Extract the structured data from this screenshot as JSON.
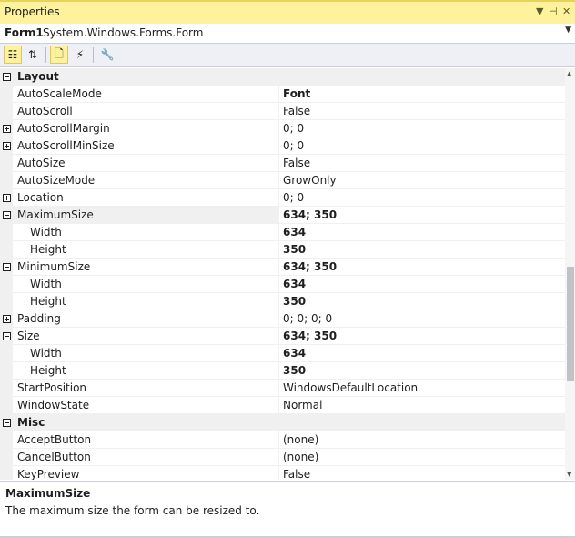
{
  "window": {
    "title": "Properties",
    "buttons": [
      "▼",
      "⊣",
      "✕"
    ]
  },
  "object_selector": {
    "name": "Form1",
    "type": "System.Windows.Forms.Form"
  },
  "toolbar": {
    "buttons": [
      {
        "name": "categorized-button",
        "glyph": "☷",
        "active": true
      },
      {
        "name": "alphabetical-button",
        "glyph": "⇅",
        "active": false
      },
      {
        "name": "properties-button",
        "glyph": "🗋",
        "active": true
      },
      {
        "name": "events-button",
        "glyph": "⚡",
        "active": false
      },
      {
        "name": "property-pages-button",
        "glyph": "🔧",
        "active": false,
        "disabled": true
      }
    ]
  },
  "grid": {
    "rows": [
      {
        "kind": "category",
        "name": "Layout",
        "expander": "minus"
      },
      {
        "kind": "prop",
        "name": "AutoScaleMode",
        "value": "Font",
        "bold": true
      },
      {
        "kind": "prop",
        "name": "AutoScroll",
        "value": "False"
      },
      {
        "kind": "prop",
        "name": "AutoScrollMargin",
        "value": "0; 0",
        "expander": "plus"
      },
      {
        "kind": "prop",
        "name": "AutoScrollMinSize",
        "value": "0; 0",
        "expander": "plus"
      },
      {
        "kind": "prop",
        "name": "AutoSize",
        "value": "False"
      },
      {
        "kind": "prop",
        "name": "AutoSizeMode",
        "value": "GrowOnly"
      },
      {
        "kind": "prop",
        "name": "Location",
        "value": "0; 0",
        "expander": "plus"
      },
      {
        "kind": "prop",
        "name": "MaximumSize",
        "value": "634; 350",
        "bold": true,
        "expander": "minus",
        "selected": true
      },
      {
        "kind": "sub",
        "name": "Width",
        "value": "634",
        "bold": true
      },
      {
        "kind": "sub",
        "name": "Height",
        "value": "350",
        "bold": true
      },
      {
        "kind": "prop",
        "name": "MinimumSize",
        "value": "634; 350",
        "bold": true,
        "expander": "minus"
      },
      {
        "kind": "sub",
        "name": "Width",
        "value": "634",
        "bold": true
      },
      {
        "kind": "sub",
        "name": "Height",
        "value": "350",
        "bold": true
      },
      {
        "kind": "prop",
        "name": "Padding",
        "value": "0; 0; 0; 0",
        "expander": "plus"
      },
      {
        "kind": "prop",
        "name": "Size",
        "value": "634; 350",
        "bold": true,
        "expander": "minus"
      },
      {
        "kind": "sub",
        "name": "Width",
        "value": "634",
        "bold": true
      },
      {
        "kind": "sub",
        "name": "Height",
        "value": "350",
        "bold": true
      },
      {
        "kind": "prop",
        "name": "StartPosition",
        "value": "WindowsDefaultLocation"
      },
      {
        "kind": "prop",
        "name": "WindowState",
        "value": "Normal"
      },
      {
        "kind": "category",
        "name": "Misc",
        "expander": "minus"
      },
      {
        "kind": "prop",
        "name": "AcceptButton",
        "value": "(none)"
      },
      {
        "kind": "prop",
        "name": "CancelButton",
        "value": "(none)"
      },
      {
        "kind": "prop",
        "name": "KeyPreview",
        "value": "False"
      }
    ]
  },
  "description": {
    "title": "MaximumSize",
    "text": "The maximum size the form can be resized to."
  },
  "colors": {
    "title_bar": "#fff29d",
    "category_bg": "#f0f0f0",
    "toolbar_bg": "#eef0f5"
  }
}
